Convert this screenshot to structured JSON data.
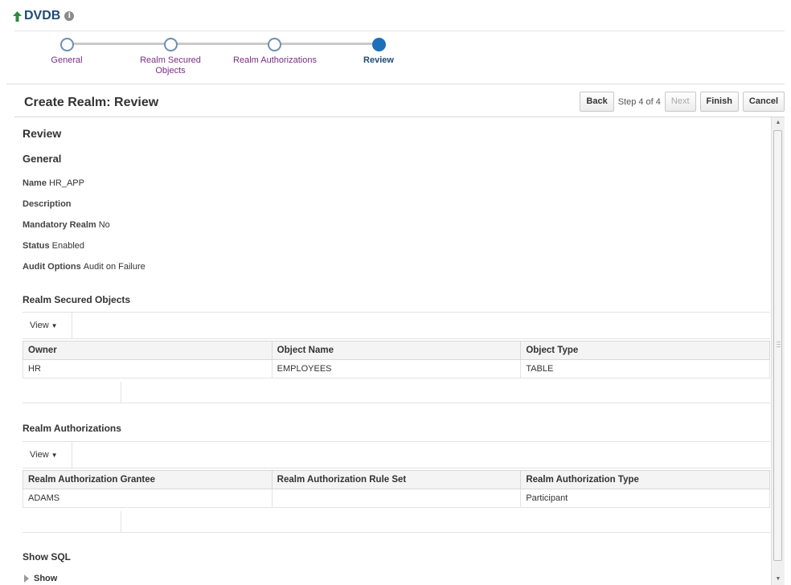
{
  "header": {
    "title": "DVDB",
    "info_icon": "info-icon",
    "up_icon": "arrow-up-icon",
    "accent": "#2e8b3e"
  },
  "train": {
    "steps": [
      {
        "label": "General",
        "state": "done"
      },
      {
        "label": "Realm Secured Objects",
        "state": "done"
      },
      {
        "label": "Realm Authorizations",
        "state": "done"
      },
      {
        "label": "Review",
        "state": "current"
      }
    ]
  },
  "page": {
    "title": "Create Realm: Review",
    "back_label": "Back",
    "step_info": "Step 4 of 4",
    "next_label": "Next",
    "finish_label": "Finish",
    "cancel_label": "Cancel"
  },
  "review": {
    "heading": "Review",
    "general_heading": "General",
    "fields": [
      {
        "label": "Name",
        "value": "HR_APP"
      },
      {
        "label": "Description",
        "value": ""
      },
      {
        "label": "Mandatory Realm",
        "value": "No"
      },
      {
        "label": "Status",
        "value": "Enabled"
      },
      {
        "label": "Audit Options",
        "value": "Audit on Failure"
      }
    ]
  },
  "secured_objects": {
    "heading": "Realm Secured Objects",
    "view_label": "View",
    "columns": [
      "Owner",
      "Object Name",
      "Object Type"
    ],
    "rows": [
      [
        "HR",
        "EMPLOYEES",
        "TABLE"
      ]
    ]
  },
  "authorizations": {
    "heading": "Realm Authorizations",
    "view_label": "View",
    "columns": [
      "Realm Authorization Grantee",
      "Realm Authorization Rule Set",
      "Realm Authorization Type"
    ],
    "rows": [
      [
        "ADAMS",
        "",
        "Participant"
      ]
    ]
  },
  "show_sql": {
    "heading": "Show SQL",
    "toggle_label": "Show"
  }
}
